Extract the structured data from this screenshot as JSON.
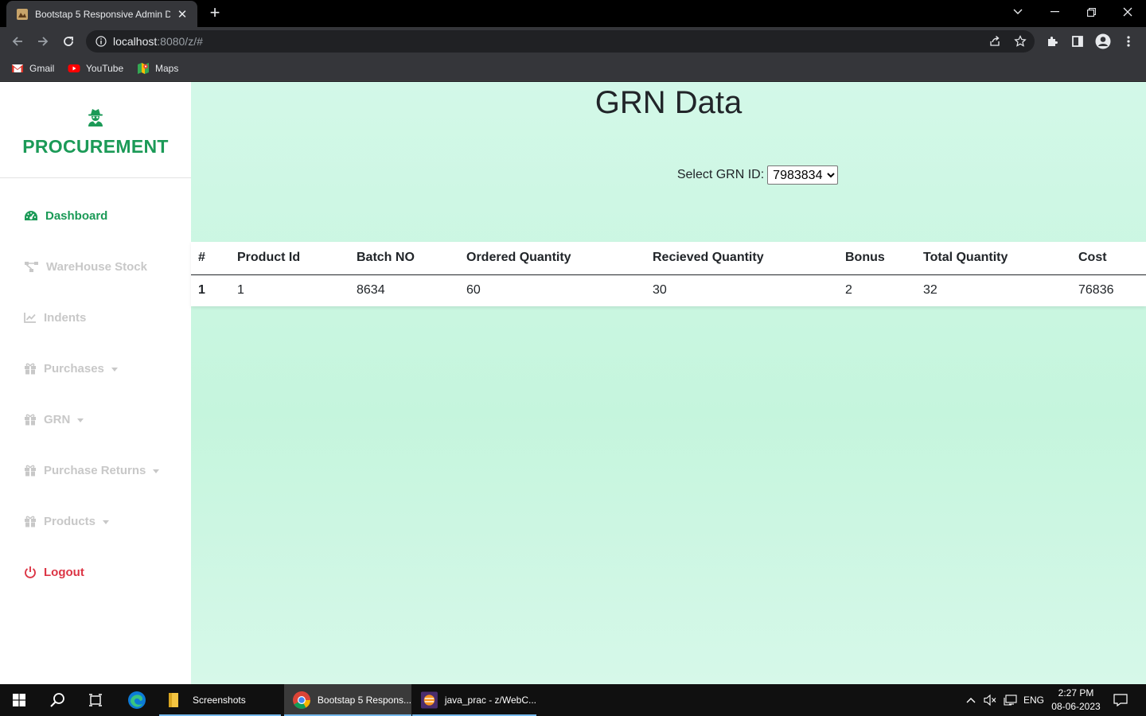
{
  "browser": {
    "tab_title": "Bootstap 5 Responsive Admin Da",
    "url_host": "localhost",
    "url_rest": ":8080/z/#",
    "bookmarks": [
      {
        "label": "Gmail",
        "icon": "gmail-icon"
      },
      {
        "label": "YouTube",
        "icon": "youtube-icon"
      },
      {
        "label": "Maps",
        "icon": "maps-icon"
      }
    ]
  },
  "sidebar": {
    "brand": "PROCUREMENT",
    "brand_icon": "user-secret-icon",
    "items": [
      {
        "label": "Dashboard",
        "icon": "tachometer-icon",
        "active": true
      },
      {
        "label": "WareHouse Stock",
        "icon": "project-diagram-icon"
      },
      {
        "label": "Indents",
        "icon": "line-chart-icon"
      },
      {
        "label": "Purchases",
        "icon": "gift-icon",
        "dropdown": true
      },
      {
        "label": "GRN",
        "icon": "gift-icon",
        "dropdown": true
      },
      {
        "label": "Purchase Returns",
        "icon": "gift-icon",
        "dropdown": true
      },
      {
        "label": "Products",
        "icon": "gift-icon",
        "dropdown": true
      },
      {
        "label": "Logout",
        "icon": "power-icon"
      }
    ]
  },
  "main": {
    "title": "GRN Data",
    "select_label": "Select GRN ID:",
    "selected_grn": "7983834",
    "table": {
      "headers": [
        "#",
        "Product Id",
        "Batch NO",
        "Ordered Quantity",
        "Recieved Quantity",
        "Bonus",
        "Total Quantity",
        "Cost"
      ],
      "rows": [
        [
          "1",
          "1",
          "8634",
          "60",
          "30",
          "2",
          "32",
          "76836"
        ]
      ]
    }
  },
  "taskbar": {
    "apps": [
      {
        "label": "Screenshots",
        "icon": "folder-icon"
      },
      {
        "label": "Bootstap 5 Respons...",
        "icon": "chrome-icon"
      },
      {
        "label": "java_prac - z/WebC...",
        "icon": "eclipse-icon"
      }
    ],
    "language": "ENG",
    "time": "2:27 PM",
    "date": "08-06-2023"
  },
  "colors": {
    "brand_green": "#1b9a57",
    "logout_red": "#dc3545",
    "main_bg": "#c5f5dd",
    "nav_inactive": "#c8c8c8"
  }
}
